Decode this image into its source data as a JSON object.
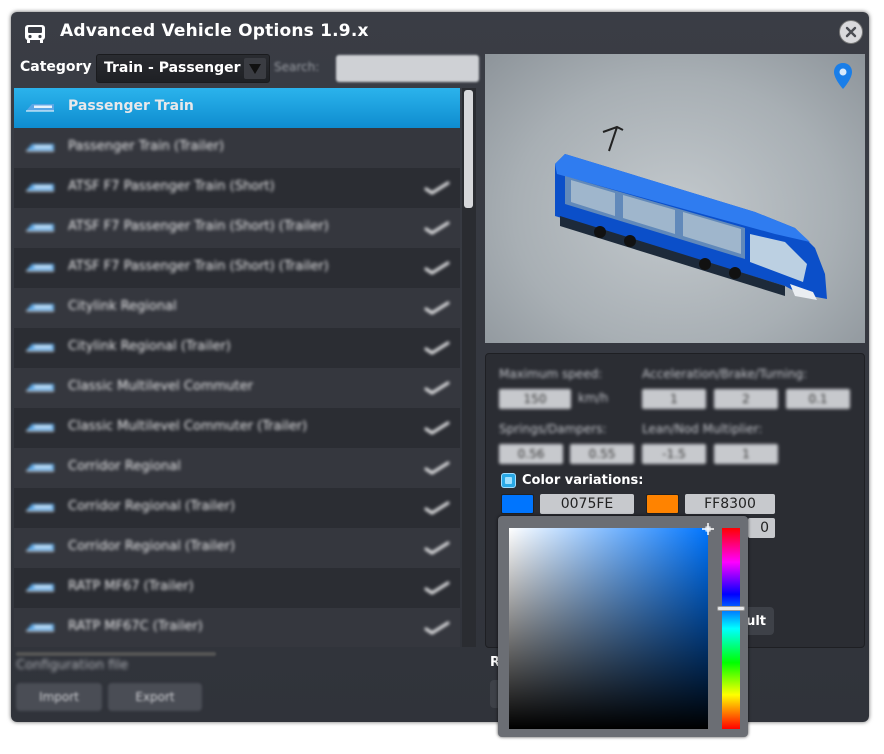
{
  "window": {
    "title": "Advanced Vehicle Options 1.9.x",
    "icon": "vehicle-icon",
    "close_icon": "close-icon"
  },
  "category": {
    "label": "Category :",
    "value": "Train - Passenger"
  },
  "search": {
    "label": "Search:",
    "value": ""
  },
  "vehicle_list": {
    "items": [
      {
        "label": "Passenger Train",
        "selected": true,
        "enabled_check": false
      },
      {
        "label": "Passenger Train (Trailer)",
        "selected": false,
        "enabled_check": false
      },
      {
        "label": "ATSF F7 Passenger Train (Short)",
        "selected": false,
        "enabled_check": true
      },
      {
        "label": "ATSF F7 Passenger Train (Short) (Trailer)",
        "selected": false,
        "enabled_check": true
      },
      {
        "label": "ATSF F7 Passenger Train (Short) (Trailer)",
        "selected": false,
        "enabled_check": true
      },
      {
        "label": "Citylink Regional",
        "selected": false,
        "enabled_check": true
      },
      {
        "label": "Citylink Regional (Trailer)",
        "selected": false,
        "enabled_check": true
      },
      {
        "label": "Classic Multilevel Commuter",
        "selected": false,
        "enabled_check": true
      },
      {
        "label": "Classic Multilevel Commuter (Trailer)",
        "selected": false,
        "enabled_check": true
      },
      {
        "label": "Corridor Regional",
        "selected": false,
        "enabled_check": true
      },
      {
        "label": "Corridor Regional (Trailer)",
        "selected": false,
        "enabled_check": true
      },
      {
        "label": "Corridor Regional (Trailer)",
        "selected": false,
        "enabled_check": true
      },
      {
        "label": "RATP MF67 (Trailer)",
        "selected": false,
        "enabled_check": true
      },
      {
        "label": "RATP MF67C (Trailer)",
        "selected": false,
        "enabled_check": true
      }
    ]
  },
  "bottom_left": {
    "label": "Configuration file",
    "button1": "Import",
    "button2": "Export"
  },
  "preview": {
    "pin_icon": "location-pin-icon",
    "vehicle_color": "#0075FE"
  },
  "properties": {
    "max_speed_label": "Maximum speed:",
    "max_speed_value": "150",
    "max_speed_unit": "km/h",
    "accel_label": "Acceleration/Brake/Turning:",
    "accel_value": "1",
    "brake_value": "2",
    "turning_value": "0.1",
    "springs_label": "Springs/Dampers:",
    "springs_value": "0.56",
    "dampers_value": "0.55",
    "lean_label": "Lean/Nod Multiplier:",
    "lean_value": "-1.5",
    "nod_value": "1",
    "color_variations_label": "Color variations:",
    "color1_hex": "0075FE",
    "color1": "#0075FE",
    "color2_hex": "FF8300",
    "color2": "#FF8300",
    "color3_hex_partial": "0",
    "reset_label_partial": "ult",
    "r_label_partial": "R"
  },
  "color_picker": {
    "hue_color": "#0075FE"
  }
}
